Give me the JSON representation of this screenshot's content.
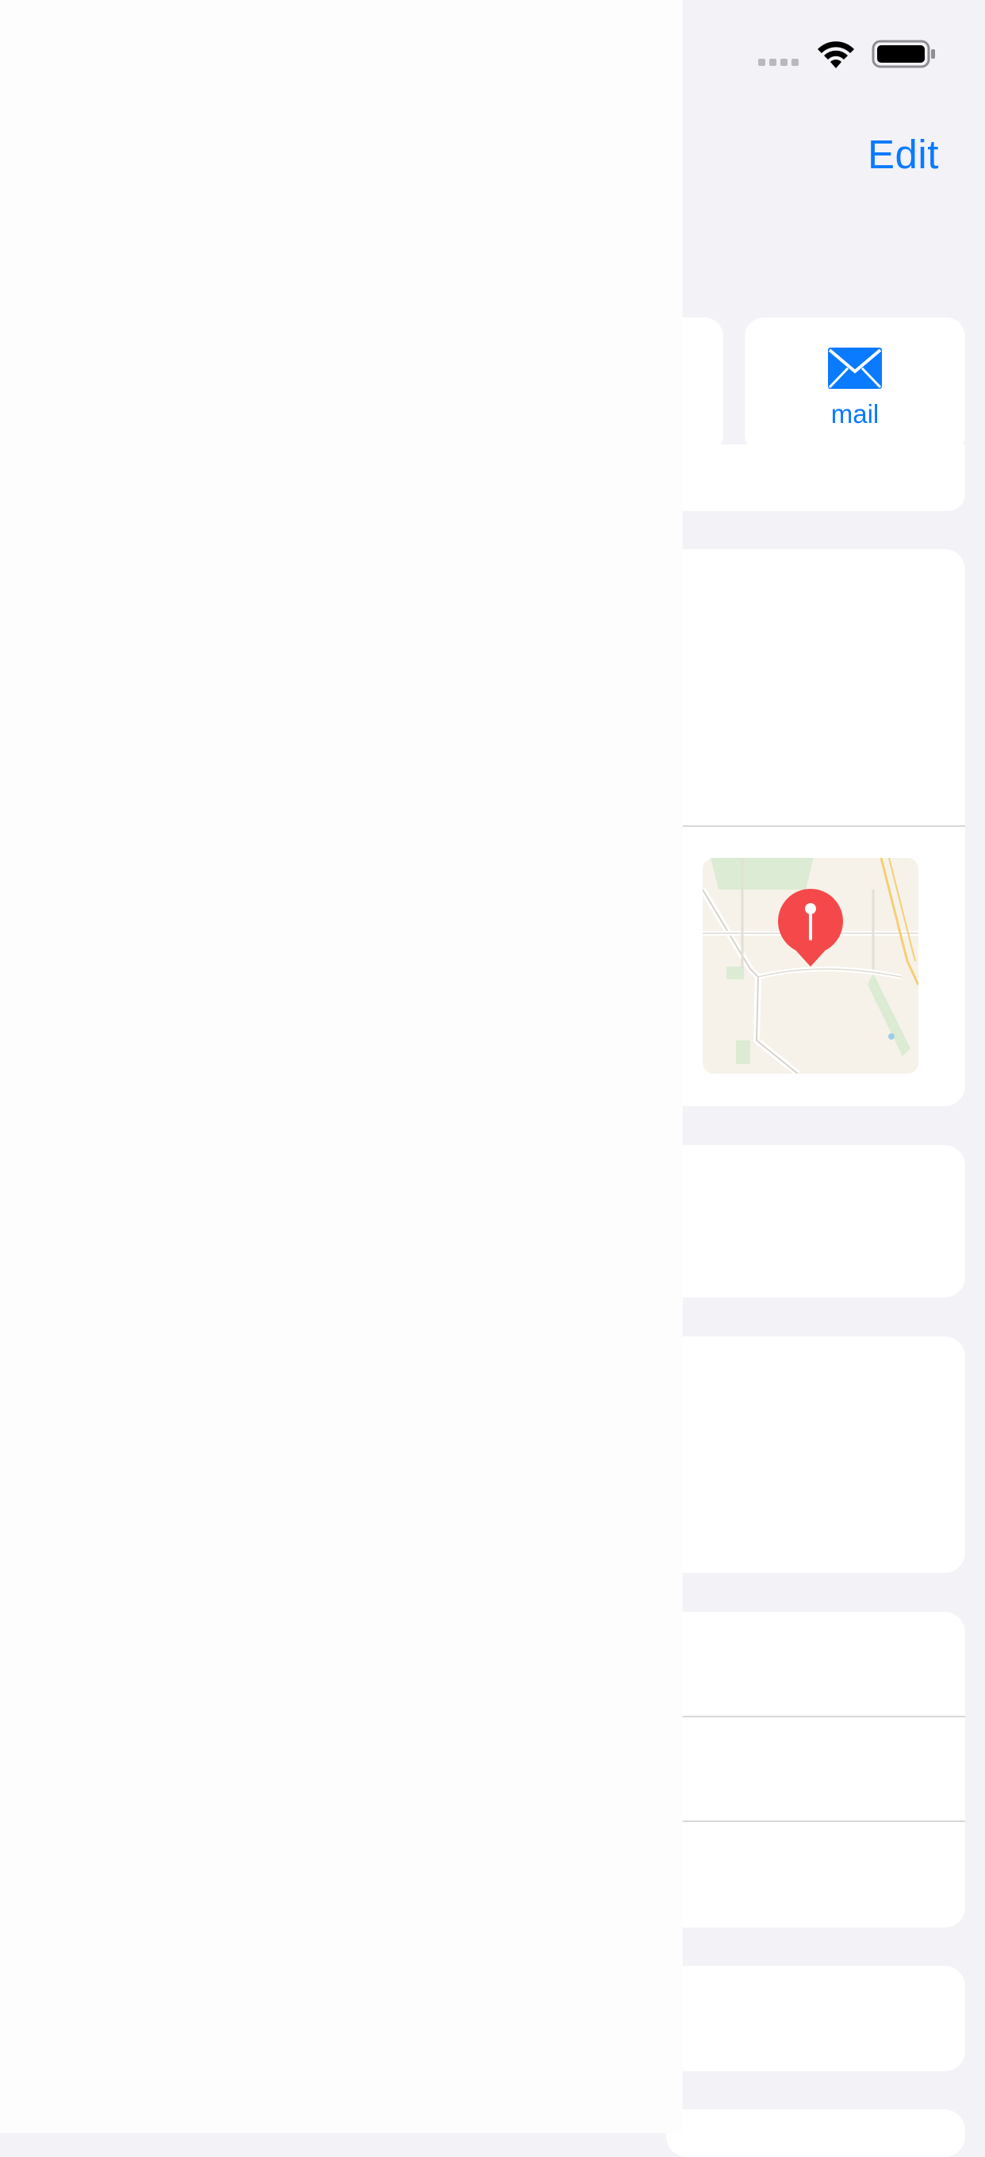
{
  "nav": {
    "edit_label": "Edit"
  },
  "actions": {
    "mail_label": "mail"
  },
  "colors": {
    "accent": "#0a7aff",
    "background": "#f2f2f7",
    "card": "#ffffff",
    "pin": "#f5484a"
  },
  "icons": {
    "wifi": "wifi-icon",
    "battery": "battery-icon",
    "mail": "mail-icon",
    "map_pin": "map-pin-icon"
  }
}
